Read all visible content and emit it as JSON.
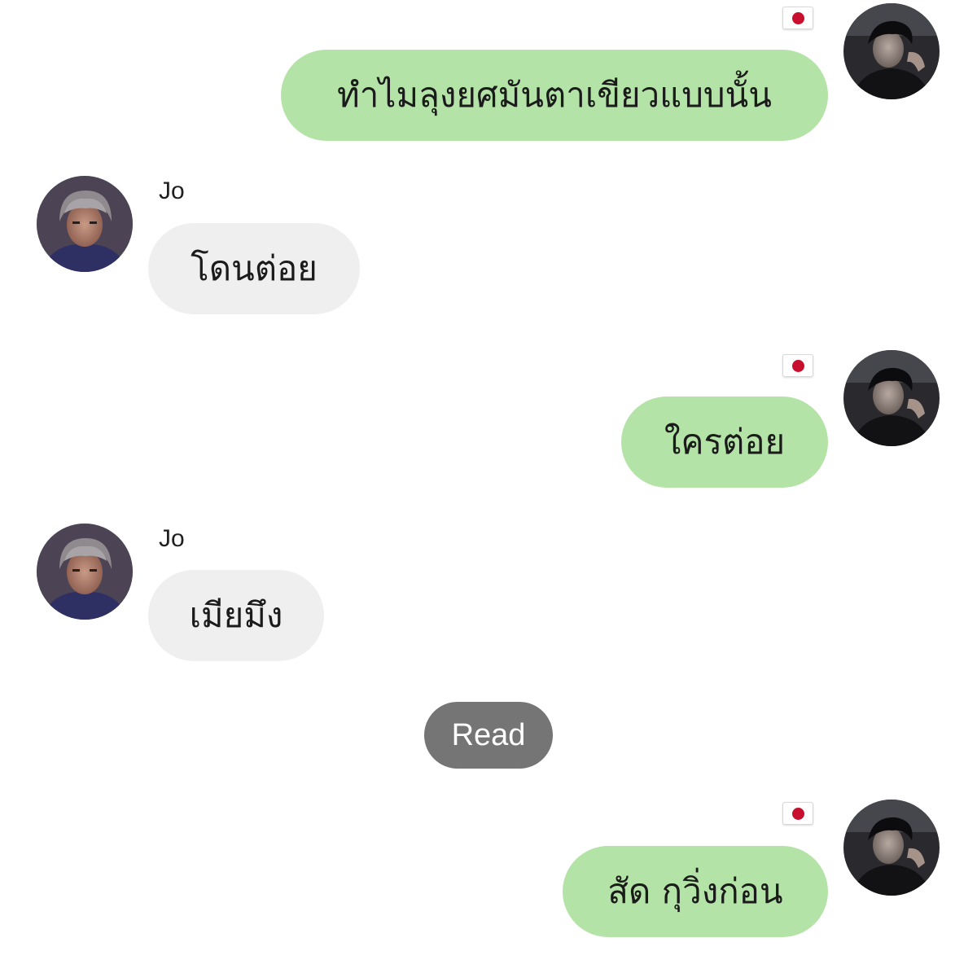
{
  "chat": {
    "messages": [
      {
        "direction": "outgoing",
        "text": "ทำไมลุงยศมันตาเขียวแบบนั้น",
        "flag_icon": "japan-flag-icon"
      },
      {
        "direction": "incoming",
        "sender": "Jo",
        "text": "โดนต่อย"
      },
      {
        "direction": "outgoing",
        "text": "ใครต่อย",
        "flag_icon": "japan-flag-icon"
      },
      {
        "direction": "incoming",
        "sender": "Jo",
        "text": "เมียมึง"
      },
      {
        "direction": "outgoing",
        "text": "สัด กุวิ่งก่อน",
        "flag_icon": "japan-flag-icon"
      }
    ],
    "read_label": "Read"
  },
  "colors": {
    "outgoing_bubble": "#b4e3a7",
    "incoming_bubble": "#efefef",
    "read_pill": "#757575",
    "background": "#ffffff"
  }
}
